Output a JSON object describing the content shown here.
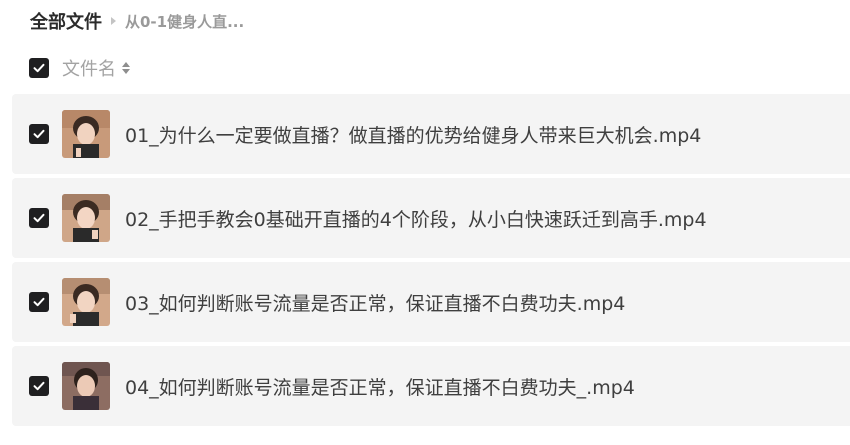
{
  "breadcrumb": {
    "root": "全部文件",
    "current": "从0-1健身人直..."
  },
  "header": {
    "column_filename": "文件名",
    "select_all_checked": true
  },
  "files": [
    {
      "name": "01_为什么一定要做直播？做直播的优势给健身人带来巨大机会.mp4",
      "checked": true,
      "thumbnail": "video-thumbnail"
    },
    {
      "name": "02_手把手教会0基础开直播的4个阶段，从小白快速跃迁到高手.mp4",
      "checked": true,
      "thumbnail": "video-thumbnail"
    },
    {
      "name": "03_如何判断账号流量是否正常，保证直播不白费功夫.mp4",
      "checked": true,
      "thumbnail": "video-thumbnail"
    },
    {
      "name": "04_如何判断账号流量是否正常，保证直播不白费功夫_.mp4",
      "checked": true,
      "thumbnail": "video-thumbnail"
    }
  ],
  "colors": {
    "checkbox": "#1f1f21",
    "row_background": "#f4f4f4",
    "file_text": "#3f3f3f",
    "header_text": "#a3a3a3"
  }
}
